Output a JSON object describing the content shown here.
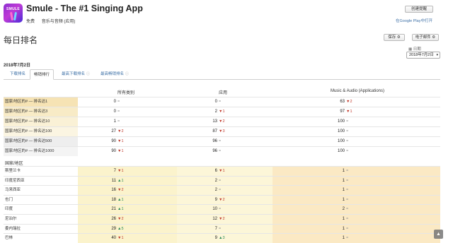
{
  "app": {
    "icon_label": "SMULE",
    "title": "Smule - The #1 Singing App",
    "price": "免费",
    "category": "音乐与音频 (应用)"
  },
  "header": {
    "create_alert": "创建提醒",
    "google_play_link": "在Google Play中打开"
  },
  "page": {
    "title": "每日排名",
    "save_button": "保存",
    "email_button": "电子邮件",
    "date_label": "日期",
    "date_value": "2018年7月2日",
    "date_heading": "2018年7月2日"
  },
  "tabs": [
    {
      "label": "下载排名",
      "active": false
    },
    {
      "label": "畅销排行",
      "active": true
    },
    {
      "label": "最高下载排名",
      "active": false
    },
    {
      "label": "最高畅销排名",
      "active": false
    }
  ],
  "columns": [
    "所有类别",
    "应用",
    "Music & Audio (Applications)"
  ],
  "summary_rows": [
    {
      "label": "国家/地区的# — 排名达1",
      "bg": "#f6e3b4",
      "cells": [
        {
          "v": "0",
          "d": "=",
          "t": "eq"
        },
        {
          "v": "0",
          "d": "=",
          "t": "eq"
        },
        {
          "v": "63",
          "d": "▼2",
          "t": "dn"
        }
      ]
    },
    {
      "label": "国家/地区的# — 排名达3",
      "bg": "#f8ebc6",
      "cells": [
        {
          "v": "0",
          "d": "=",
          "t": "eq"
        },
        {
          "v": "2",
          "d": "▼1",
          "t": "dn"
        },
        {
          "v": "97",
          "d": "▼1",
          "t": "dn"
        }
      ]
    },
    {
      "label": "国家/地区的# — 排名达10",
      "bg": "#faf1d6",
      "cells": [
        {
          "v": "1",
          "d": "=",
          "t": "eq"
        },
        {
          "v": "13",
          "d": "▼2",
          "t": "dn"
        },
        {
          "v": "100",
          "d": "=",
          "t": "eq"
        }
      ]
    },
    {
      "label": "国家/地区的# — 排名达100",
      "bg": "#fbf5e2",
      "cells": [
        {
          "v": "27",
          "d": "▼2",
          "t": "dn"
        },
        {
          "v": "87",
          "d": "▼3",
          "t": "dn"
        },
        {
          "v": "100",
          "d": "=",
          "t": "eq"
        }
      ]
    },
    {
      "label": "国家/地区的# — 排名达500",
      "bg": "#eeeeee",
      "cells": [
        {
          "v": "90",
          "d": "▼1",
          "t": "dn"
        },
        {
          "v": "96",
          "d": "=",
          "t": "eq"
        },
        {
          "v": "100",
          "d": "=",
          "t": "eq"
        }
      ]
    },
    {
      "label": "国家/地区的# — 排名达1000",
      "bg": "#f4f4f4",
      "cells": [
        {
          "v": "90",
          "d": "▼1",
          "t": "dn"
        },
        {
          "v": "96",
          "d": "=",
          "t": "eq"
        },
        {
          "v": "100",
          "d": "=",
          "t": "eq"
        }
      ]
    }
  ],
  "country_section_label": "国家/地区",
  "country_rows": [
    {
      "label": "斯里兰卡",
      "cells": [
        {
          "v": "7",
          "d": "▼1",
          "t": "dn"
        },
        {
          "v": "6",
          "d": "▼1",
          "t": "dn"
        },
        {
          "v": "1",
          "d": "=",
          "t": "eq"
        }
      ]
    },
    {
      "label": "印度尼西亚",
      "cells": [
        {
          "v": "11",
          "d": "▲1",
          "t": "up"
        },
        {
          "v": "2",
          "d": "=",
          "t": "eq"
        },
        {
          "v": "1",
          "d": "=",
          "t": "eq"
        }
      ]
    },
    {
      "label": "马来西亚",
      "cells": [
        {
          "v": "16",
          "d": "▼2",
          "t": "dn"
        },
        {
          "v": "2",
          "d": "=",
          "t": "eq"
        },
        {
          "v": "1",
          "d": "=",
          "t": "eq"
        }
      ]
    },
    {
      "label": "也门",
      "cells": [
        {
          "v": "18",
          "d": "▲1",
          "t": "up"
        },
        {
          "v": "9",
          "d": "▼2",
          "t": "dn"
        },
        {
          "v": "1",
          "d": "=",
          "t": "eq"
        }
      ]
    },
    {
      "label": "印度",
      "cells": [
        {
          "v": "21",
          "d": "▲1",
          "t": "up"
        },
        {
          "v": "10",
          "d": "=",
          "t": "eq"
        },
        {
          "v": "2",
          "d": "=",
          "t": "eq"
        }
      ]
    },
    {
      "label": "尼泊尔",
      "cells": [
        {
          "v": "26",
          "d": "▼2",
          "t": "dn"
        },
        {
          "v": "12",
          "d": "▼2",
          "t": "dn"
        },
        {
          "v": "1",
          "d": "=",
          "t": "eq"
        }
      ]
    },
    {
      "label": "委内瑞拉",
      "cells": [
        {
          "v": "29",
          "d": "▲5",
          "t": "up"
        },
        {
          "v": "7",
          "d": "=",
          "t": "eq"
        },
        {
          "v": "1",
          "d": "=",
          "t": "eq"
        }
      ]
    },
    {
      "label": "巴林",
      "cells": [
        {
          "v": "40",
          "d": "▼1",
          "t": "dn"
        },
        {
          "v": "9",
          "d": "▲3",
          "t": "up"
        },
        {
          "v": "1",
          "d": "=",
          "t": "eq"
        }
      ]
    }
  ],
  "colors": {
    "country_col1_bg": "#fbf3cc",
    "country_col2_bg": "#fcf6d8",
    "country_col3_bg": "#fbe9c4",
    "link": "#3b6ea5",
    "down": "#c0392b",
    "up": "#2e8b57"
  },
  "scroll_top_icon": "chevron-up-icon"
}
